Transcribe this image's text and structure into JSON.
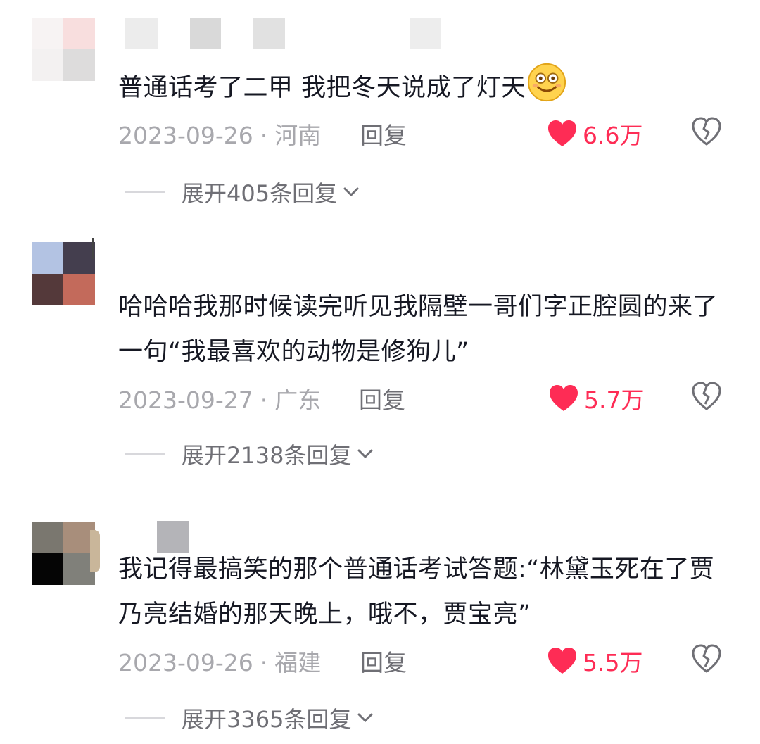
{
  "comments": [
    {
      "text": "普通话考了二甲 我把冬天说成了灯天",
      "emoji": "smiling-face-emoji",
      "date": "2023-09-26",
      "dot": "·",
      "location": "河南",
      "reply_label": "回复",
      "likes": "6.6万",
      "expand_label": "展开405条回复"
    },
    {
      "text": "哈哈哈我那时候读完听见我隔壁一哥们字正腔圆的来了一句“我最喜欢的动物是修狗儿”",
      "date": "2023-09-27",
      "dot": "·",
      "location": "广东",
      "reply_label": "回复",
      "likes": "5.7万",
      "expand_label": "展开2138条回复"
    },
    {
      "text": "我记得最搞笑的那个普通话考试答题:“林黛玉死在了贾乃亮结婚的那天晚上，哦不，贾宝亮”",
      "date": "2023-09-26",
      "dot": "·",
      "location": "福建",
      "reply_label": "回复",
      "likes": "5.5万",
      "expand_label": "展开3365条回复"
    }
  ],
  "icons": {
    "like": "heart-icon",
    "dislike": "broken-heart-icon",
    "expand": "chevron-down-icon"
  },
  "colors": {
    "like_red": "#fe2c55",
    "text": "#161823",
    "meta_gray": "#a8a8ad"
  }
}
